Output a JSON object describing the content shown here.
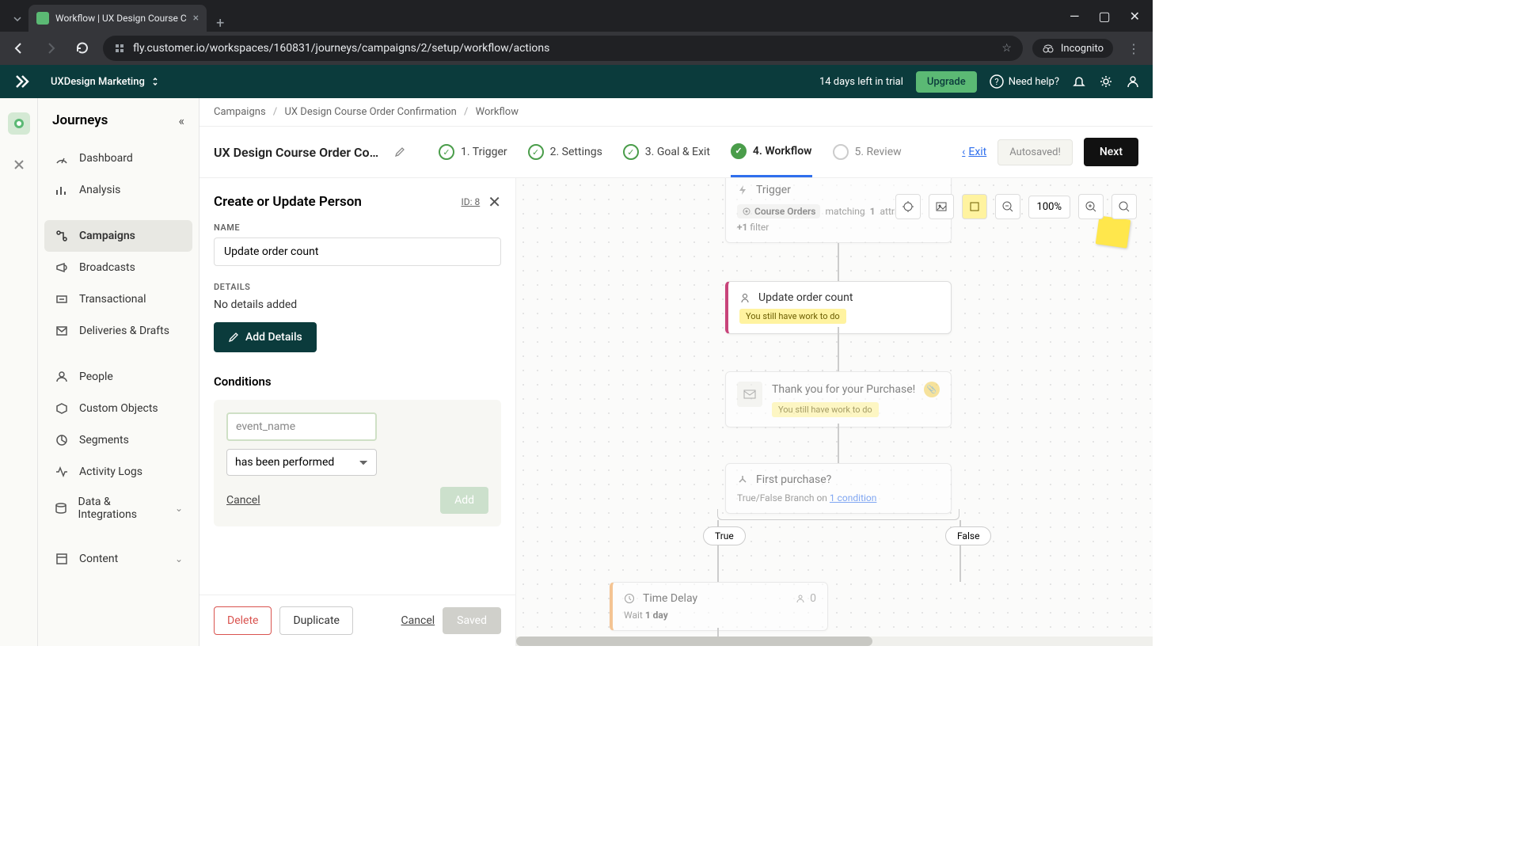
{
  "browser": {
    "tab_title": "Workflow | UX Design Course C",
    "url": "fly.customer.io/workspaces/160831/journeys/campaigns/2/setup/workflow/actions",
    "incognito": "Incognito"
  },
  "header": {
    "workspace": "UXDesign Marketing",
    "trial": "14 days left in trial",
    "upgrade": "Upgrade",
    "help": "Need help?"
  },
  "sidebar": {
    "title": "Journeys",
    "items": [
      "Dashboard",
      "Analysis",
      "Campaigns",
      "Broadcasts",
      "Transactional",
      "Deliveries & Drafts",
      "People",
      "Custom Objects",
      "Segments",
      "Activity Logs",
      "Data & Integrations",
      "Content"
    ]
  },
  "breadcrumb": {
    "a": "Campaigns",
    "b": "UX Design Course Order Confirmation",
    "c": "Workflow"
  },
  "stepper": {
    "title": "UX Design Course Order Confir…",
    "steps": [
      "1. Trigger",
      "2. Settings",
      "3. Goal & Exit",
      "4. Workflow",
      "5. Review"
    ],
    "exit": "Exit",
    "autosaved": "Autosaved!",
    "next": "Next"
  },
  "panel": {
    "title": "Create or Update Person",
    "id": "ID: 8",
    "name_label": "NAME",
    "name_value": "Update order count",
    "details_label": "DETAILS",
    "details_text": "No details added",
    "add_details": "Add Details",
    "conditions": "Conditions",
    "event_placeholder": "event_name",
    "select_value": "has been performed",
    "cancel": "Cancel",
    "add": "Add",
    "delete": "Delete",
    "duplicate": "Duplicate",
    "footer_cancel": "Cancel",
    "saved": "Saved"
  },
  "canvas": {
    "zoom": "100%",
    "trigger": "Trigger",
    "course_orders": "Course Orders",
    "matching": "matching",
    "matching_n": "1",
    "attribute": "attribute",
    "filter_plus": "+1",
    "filter": "filter",
    "update_order": "Update order count",
    "work": "You still have work to do",
    "thank_you": "Thank you for your Purchase!",
    "first_purchase": "First purchase?",
    "branch_text": "True/False Branch on",
    "branch_link": "1 condition",
    "true": "True",
    "false": "False",
    "time_delay": "Time Delay",
    "time_count": "0",
    "wait": "Wait",
    "one_day": "1 day"
  }
}
